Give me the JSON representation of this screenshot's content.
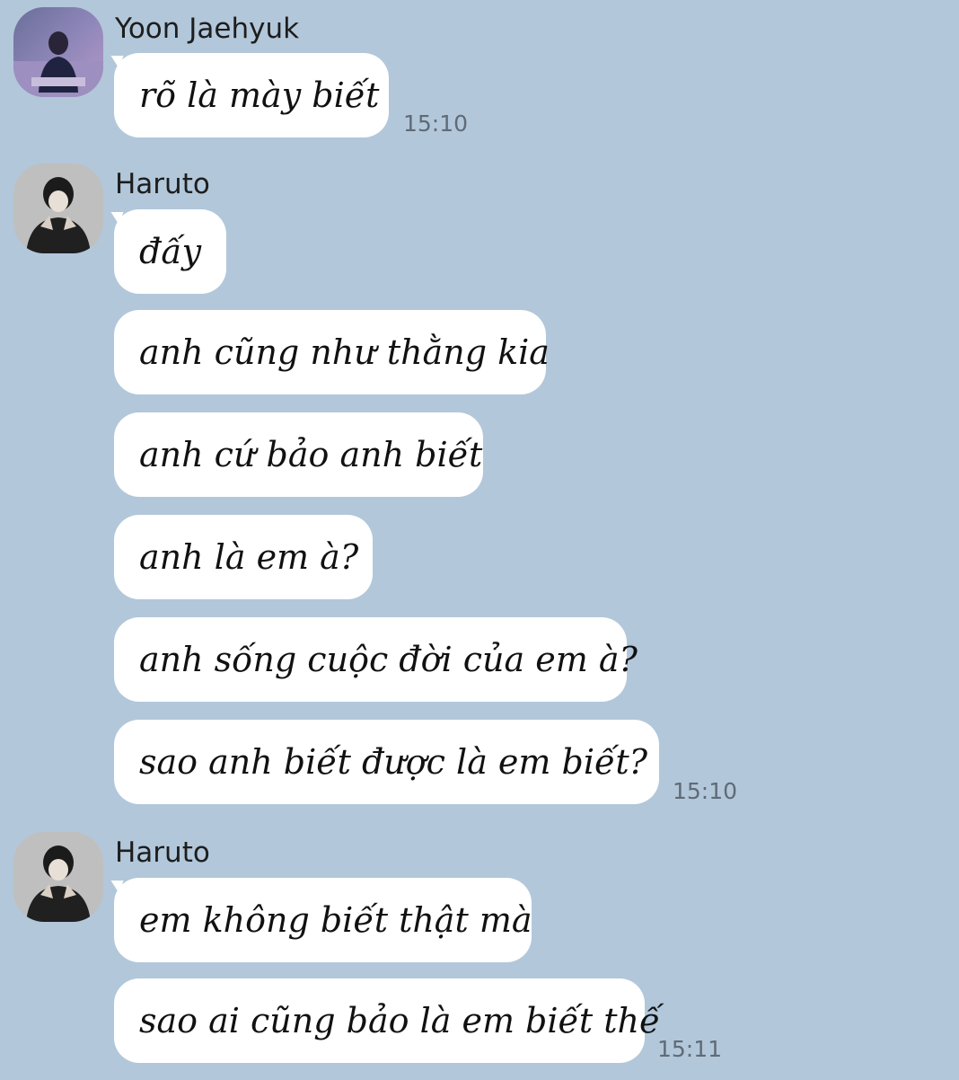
{
  "groups": [
    {
      "sender": "Yoon Jaehyuk",
      "avatar_icon": "profile-photo-yoon-jaehyuk",
      "messages": [
        "rõ là mày biết"
      ],
      "time": "15:10"
    },
    {
      "sender": "Haruto",
      "avatar_icon": "profile-photo-haruto",
      "messages": [
        "đấy",
        "anh cũng như thằng kia",
        "anh cứ bảo anh biết",
        "anh là em à?",
        "anh sống cuộc đời của em à?",
        "sao anh biết được là em biết?"
      ],
      "time": "15:10"
    },
    {
      "sender": "Haruto",
      "avatar_icon": "profile-photo-haruto",
      "messages": [
        "em không biết thật mà",
        "sao ai cũng bảo là em biết thế"
      ],
      "time": "15:11"
    }
  ],
  "colors": {
    "background": "#b2c7da",
    "bubble": "#ffffff",
    "timestamp": "#5f6b76"
  }
}
